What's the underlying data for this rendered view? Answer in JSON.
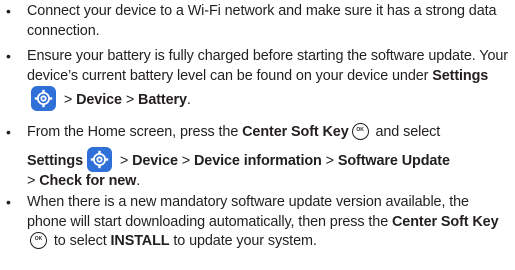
{
  "bullet_char": "•",
  "icons": {
    "settings": "settings-gear-icon",
    "center_soft_key": "center-soft-key-icon",
    "center_soft_key_glyph": "OK",
    "settings_color": "#2e6fd8"
  },
  "items": [
    {
      "t1": "Connect your device to a Wi-Fi network and make sure it has a strong data connection."
    },
    {
      "t1": "Ensure your battery is fully charged before starting the software update. Your device’s current battery level can be found on your device under ",
      "b1": "Settings",
      "t2": " > ",
      "b2": "Device",
      "t3": " > ",
      "b3": "Battery",
      "t4": "."
    },
    {
      "t1": "From the Home screen, press the ",
      "b1": "Center Soft Key",
      "t2": " and select",
      "b2": "Settings",
      "t3": " > ",
      "b3": "Device",
      "t4": " > ",
      "b4": "Device information",
      "t5": " > ",
      "b5": "Software Update",
      "t6": "> ",
      "b6": "Check for new",
      "t7": "."
    },
    {
      "t1": "When there is a new mandatory software update version available, the phone will start downloading automatically, then press the ",
      "b1": "Center Soft Key",
      "t2": " to select ",
      "b2": "INSTALL",
      "t3": " to update your system."
    }
  ]
}
